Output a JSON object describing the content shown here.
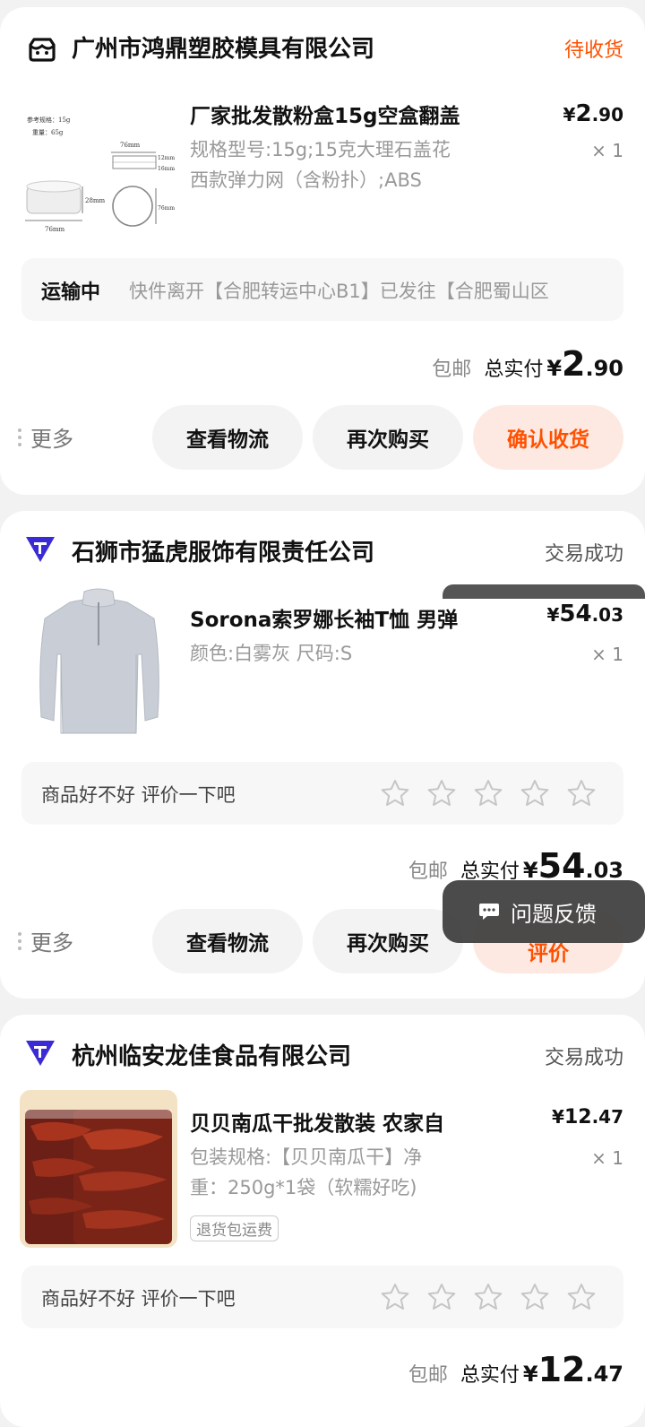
{
  "orders": [
    {
      "shop": "广州市鸿鼎塑胶模具有限公司",
      "status": "待收货",
      "product_title": "厂家批发散粉盒15g空盒翻盖",
      "spec_line1": "规格型号:15g;15克大理石盖花",
      "spec_line2": "西款弹力网（含粉扑）;ABS",
      "price_yen": "¥",
      "price_int": "2",
      "price_dec": ".90",
      "qty": "× 1",
      "thumb_labels": {
        "ref": "参考规格：15g",
        "weight": "重量：65g",
        "w76a": "76mm",
        "h12": "12mm",
        "h16": "16mm",
        "h28": "28mm",
        "w76b": "76mm",
        "h76": "76mm"
      },
      "logistics_label": "运输中",
      "logistics_text": "快件离开【合肥转运中心B1】已发往【合肥蜀山区",
      "free_shipping": "包邮",
      "total_label": "总实付",
      "total_yen": "¥",
      "total_int": "2",
      "total_dec": ".90",
      "more": "更多",
      "btn1": "查看物流",
      "btn2": "再次购买",
      "btn3": "确认收货"
    },
    {
      "shop": "石狮市猛虎服饰有限责任公司",
      "status": "交易成功",
      "product_title": "Sorona索罗娜长袖T恤 男弹",
      "spec_line1": "颜色:白雾灰 尺码:S",
      "price_yen": "¥",
      "price_int": "54",
      "price_dec": ".03",
      "qty": "× 1",
      "review_prompt": "商品好不好 评价一下吧",
      "rating_stars": 0,
      "free_shipping": "包邮",
      "total_label": "总实付",
      "total_yen": "¥",
      "total_int": "54",
      "total_dec": ".03",
      "more": "更多",
      "btn1": "查看物流",
      "btn2": "再次购买",
      "btn3": "评价"
    },
    {
      "shop": "杭州临安龙佳食品有限公司",
      "status": "交易成功",
      "product_title": "贝贝南瓜干批发散装 农家自",
      "spec_line1": "包装规格:【贝贝南瓜干】净",
      "spec_line2": "重：250g*1袋（软糯好吃)",
      "tag": "退货包运费",
      "price_yen": "¥",
      "price_int": "12",
      "price_dec": ".47",
      "qty": "× 1",
      "review_prompt": "商品好不好 评价一下吧",
      "rating_stars": 0,
      "free_shipping": "包邮",
      "total_label": "总实付",
      "total_yen": "¥",
      "total_int": "12",
      "total_dec": ".47"
    }
  ],
  "feedback_button": "问题反馈",
  "colors": {
    "accent": "#ff5000",
    "brand_purple": "#3b2bd4"
  }
}
